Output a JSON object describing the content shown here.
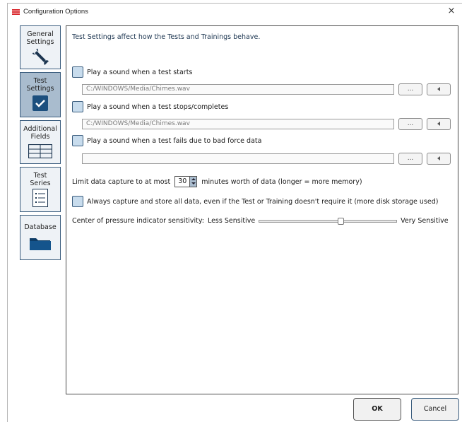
{
  "window": {
    "title": "Configuration Options",
    "close_glyph": "×",
    "app_icon": "red-stripes-icon",
    "accent_color": "#3b5d7e",
    "active_nav_color": "#a9bcce"
  },
  "sidebar": {
    "items": [
      {
        "label_line1": "General",
        "label_line2": "Settings",
        "icon": "wrench-icon",
        "active": false
      },
      {
        "label_line1": "Test",
        "label_line2": "Settings",
        "icon": "checkmark-icon",
        "active": true
      },
      {
        "label_line1": "Additional",
        "label_line2": "Fields",
        "icon": "table-grid-icon",
        "active": false
      },
      {
        "label_line1": "Test",
        "label_line2": "Series",
        "icon": "list-icon",
        "active": false
      },
      {
        "label_line1": "Database",
        "label_line2": "",
        "icon": "folder-icon",
        "active": false
      }
    ]
  },
  "main": {
    "description": "Test Settings affect how the Tests and Trainings behave.",
    "sounds": [
      {
        "label": "Play a sound when a test starts",
        "path": "C:/WINDOWS/Media/Chimes.wav",
        "checked": false
      },
      {
        "label": "Play a sound when a test stops/completes",
        "path": "C:/WINDOWS/Media/Chimes.wav",
        "checked": false
      },
      {
        "label": "Play a sound when a test fails due to bad force data",
        "path": "",
        "checked": false
      }
    ],
    "browse_label": "...",
    "limit": {
      "prefix": "Limit data capture to at most",
      "value": "30",
      "suffix": "minutes worth of data (longer = more memory)"
    },
    "always_capture": {
      "label": "Always capture and store all data, even if the Test or Training doesn't require it (more disk storage used)",
      "checked": false
    },
    "sensitivity": {
      "label": "Center of pressure indicator sensitivity:",
      "low": "Less Sensitive",
      "high": "Very Sensitive",
      "value_fraction": 0.6
    }
  },
  "footer": {
    "ok_label": "OK",
    "cancel_label": "Cancel"
  }
}
